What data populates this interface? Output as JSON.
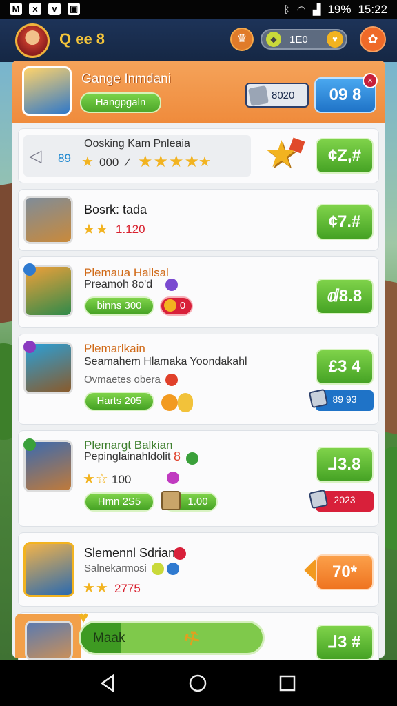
{
  "status_bar": {
    "left_icons": [
      "M",
      "x",
      "v",
      "img"
    ],
    "battery": "19%",
    "time": "15:22"
  },
  "top_bar": {
    "player_name": "Q ee 8",
    "coin_value": "1E0",
    "colors": {
      "bar": "#1d3358",
      "gold": "#f5c53a",
      "orange": "#ef6a28"
    }
  },
  "featured": {
    "title": "Gange Inmdani",
    "tag": "Hangpgaln",
    "stat_value": "8020",
    "action_label": "09 8",
    "close_symbol": "×"
  },
  "cards": [
    {
      "title": "Oosking Kam Pnleaia",
      "left_number": "89",
      "score": "000",
      "mark": "⁄",
      "stars": "★★★★",
      "stars_small": "★",
      "price": "¢Z,#"
    },
    {
      "title": "Bosrk: tada",
      "stars": "★★",
      "number": "1.120",
      "price": "¢7.#"
    },
    {
      "title": "Plemaua Hallsal",
      "subtitle": "Preamoh 8o'd",
      "pill": "binns 300",
      "badge": "0",
      "price": "ⅆ8.8"
    },
    {
      "title": "Plemarlkain",
      "subtitle": "Seamahem Hlamaka Yoondakahl",
      "sub2": "Ovmaetes obera",
      "pill": "Harts 205",
      "price": "£3 4",
      "rank": "89 93"
    },
    {
      "title": "Plemargt Balkian",
      "subtitle": "Pepinglainahldolit",
      "sub_mark": "8",
      "stars": "★☆",
      "number": "100",
      "pill": "Hmn 2S5",
      "chip": "1.00",
      "price": "⅃3.8",
      "rank": "2023"
    },
    {
      "title": "Slemennl Sdrian",
      "subtitle": "Salnekarmosi",
      "stars": "★★",
      "number": "2775",
      "price": "70*"
    },
    {
      "progress_label": "Maak",
      "progress": 0.22,
      "price": "⅃3 #"
    }
  ],
  "nav": {
    "back": "◁",
    "home": "○",
    "recents": "□"
  }
}
